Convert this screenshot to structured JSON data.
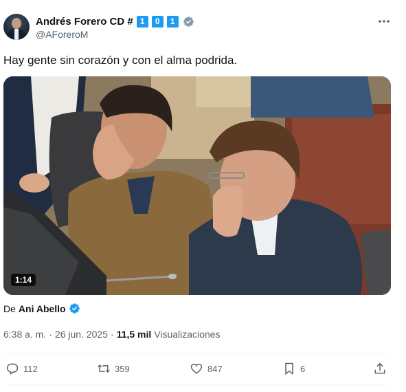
{
  "author": {
    "display_name": "Andrés Forero CD #",
    "number_boxes": [
      "1",
      "0",
      "1"
    ],
    "handle": "@AForeroM",
    "verified": "gray-verified-icon"
  },
  "tweet": {
    "text": "Hay gente sin corazón y con el alma podrida."
  },
  "media": {
    "type": "video",
    "duration": "1:14"
  },
  "source": {
    "prefix": "De",
    "name": "Ani Abello",
    "verified": "blue-verified-icon"
  },
  "meta": {
    "time": "6:38 a. m.",
    "separator": "·",
    "date": "26 jun. 2025",
    "views_count": "11,5 mil",
    "views_label": "Visualizaciones"
  },
  "actions": {
    "replies": "112",
    "reposts": "359",
    "likes": "847",
    "bookmarks": "6"
  },
  "colors": {
    "accent": "#1d9bf0",
    "text": "#0f1419",
    "secondary": "#536471"
  }
}
